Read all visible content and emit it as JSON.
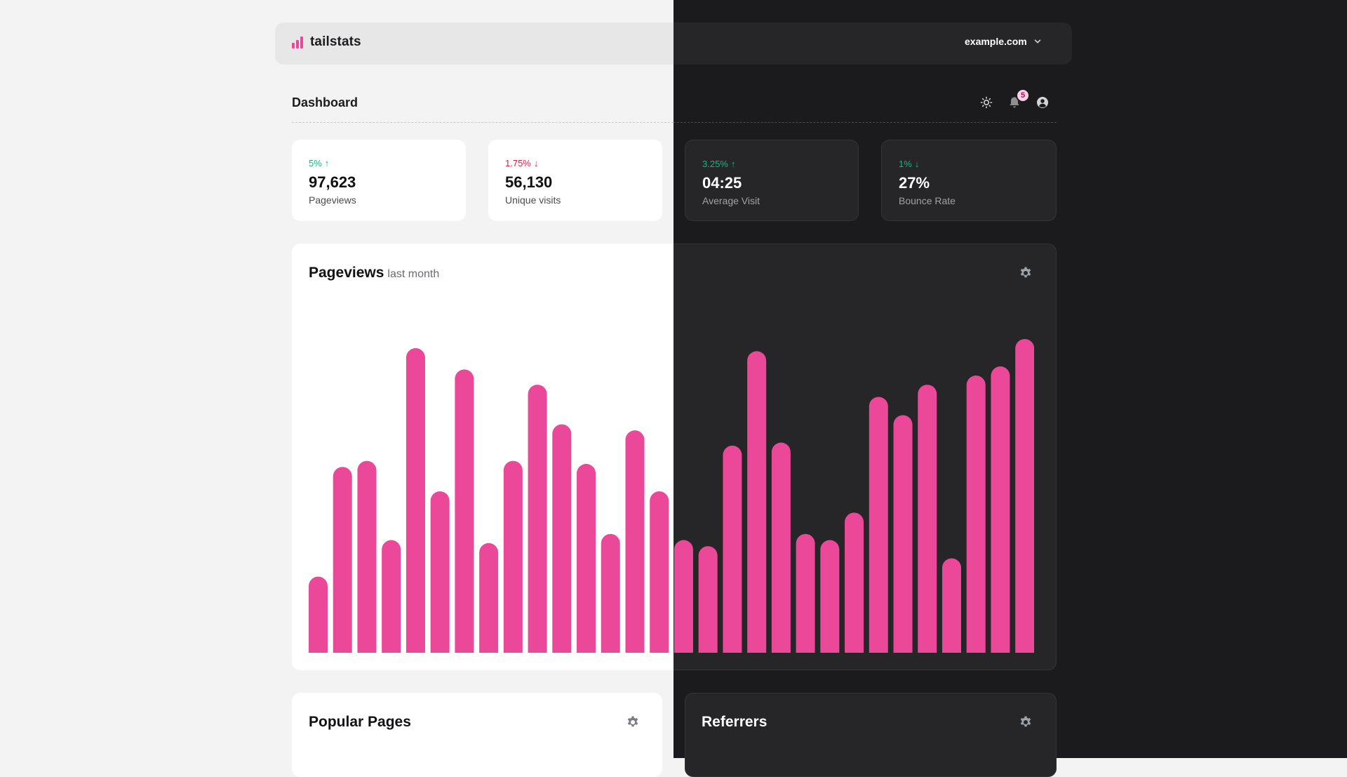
{
  "brand": {
    "name": "tailstats"
  },
  "site_selector": {
    "value": "example.com"
  },
  "header": {
    "title": "Dashboard",
    "notification_count": "5"
  },
  "stats": [
    {
      "delta": "5%",
      "direction": "up",
      "value": "97,623",
      "label": "Pageviews"
    },
    {
      "delta": "1.75%",
      "direction": "down",
      "value": "56,130",
      "label": "Unique visits"
    },
    {
      "delta": "3.25%",
      "direction": "up",
      "value": "04:25",
      "label": "Average Visit"
    },
    {
      "delta": "1%",
      "direction": "down",
      "value": "27%",
      "label": "Bounce Rate"
    }
  ],
  "pageviews_panel": {
    "title": "Pageviews",
    "subtitle": "last month"
  },
  "chart_data": {
    "type": "bar",
    "title": "Pageviews",
    "subtitle": "last month",
    "xlabel": "",
    "ylabel": "",
    "ylim": [
      0,
      100
    ],
    "grid": false,
    "bar_color": "#ec4899",
    "values": [
      25,
      61,
      63,
      37,
      100,
      53,
      93,
      36,
      63,
      88,
      75,
      62,
      39,
      73,
      53,
      37,
      35,
      68,
      99,
      69,
      39,
      37,
      46,
      84,
      78,
      88,
      31,
      91,
      94,
      103
    ]
  },
  "popular_pages": {
    "title": "Popular Pages"
  },
  "referrers": {
    "title": "Referrers"
  },
  "colors": {
    "accent": "#ec4899",
    "positive": "#10b981",
    "negative": "#e11d48",
    "dark_bg": "#1b1b1d",
    "light_bg": "#f3f3f3"
  }
}
